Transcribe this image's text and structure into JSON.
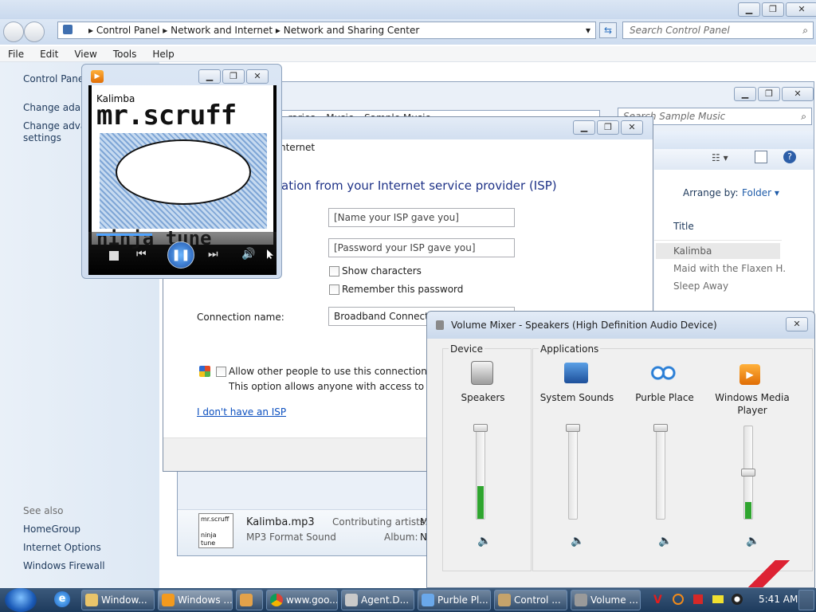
{
  "control_panel": {
    "breadcrumb": [
      "Control Panel",
      "Network and Internet",
      "Network and Sharing Center"
    ],
    "search_placeholder": "Search Control Panel",
    "menu": [
      "File",
      "Edit",
      "View",
      "Tools",
      "Help"
    ],
    "sidebar": {
      "home": "Control Panel",
      "link1": "Change adapt",
      "link2a": "Change advan",
      "link2b": "settings",
      "see_also": "See also",
      "see_also_items": [
        "HomeGroup",
        "Internet Options",
        "Windows Firewall"
      ]
    }
  },
  "library": {
    "breadcrumb_partial": "...raries ▸ Music ▸ Sample Music",
    "search_placeholder": "Search Sample Music",
    "arrange_by_label": "Arrange by:",
    "arrange_by_value": "Folder",
    "column_title": "Title",
    "tracks": [
      "Kalimba",
      "Maid with the Flaxen H...",
      "Sleep Away"
    ],
    "details": {
      "filename": "Kalimba.mp3",
      "type": "MP3 Format Sound",
      "contributing_label": "Contributing artists:",
      "contributing_partial": "M",
      "album_label": "Album:",
      "album_partial": "N"
    }
  },
  "isp_dialog": {
    "title_partial": "nternet",
    "heading": "ation from your Internet service provider (ISP)",
    "username_value": "[Name your ISP gave you]",
    "password_value": "[Password your ISP gave you]",
    "show_characters": "Show characters",
    "remember_password": "Remember this password",
    "connection_name_label": "Connection name:",
    "connection_name_value": "Broadband Connectio",
    "allow_others": "Allow other people to use this connection",
    "allow_others_desc": "This option allows anyone with access to this co",
    "no_isp_link": "I don't have an ISP"
  },
  "media_player": {
    "track_title": "Kalimba",
    "album_art_top": "mr.scruff",
    "album_art_bottom": "ninja tune"
  },
  "volume_mixer": {
    "title": "Volume Mixer - Speakers (High Definition Audio Device)",
    "device_label": "Device",
    "applications_label": "Applications",
    "channels": [
      {
        "name": "Speakers",
        "level": 0.35
      },
      {
        "name": "System Sounds",
        "level": 0
      },
      {
        "name": "Purble Place",
        "level": 0
      },
      {
        "name": "Windows Media Player",
        "level": 0.18
      }
    ]
  },
  "taskbar": {
    "buttons": [
      "Window...",
      "Windows ...",
      "",
      "www.goo...",
      "Agent.D...",
      "Purble Pl...",
      "Control ...",
      "Volume ..."
    ],
    "clock": "5:41 AM"
  },
  "colors": {
    "accent": "#1e5ba8",
    "title_text": "#1e395b",
    "level_green": "#2fa52f"
  }
}
